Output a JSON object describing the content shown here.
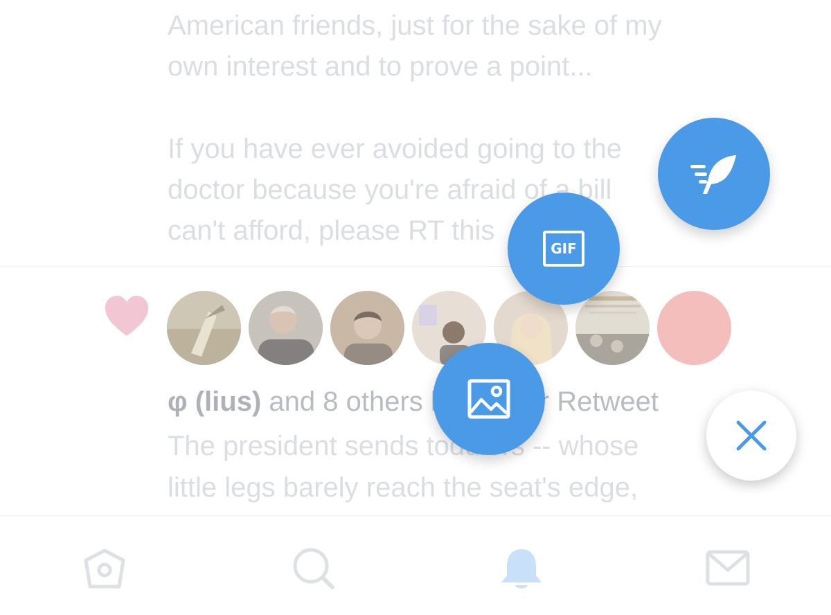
{
  "tweet1": {
    "line1": "American friends, just for the sake of my",
    "line2": "own interest and to prove a point...",
    "line3": "If you have ever avoided going to the",
    "line4": "doctor because you're afraid of a bill",
    "line5": "can't afford, please RT this"
  },
  "notification": {
    "actor": "φ (lius)",
    "summary_pre": " and 8 others liked your Retweet",
    "tweet_line1": "The president sends toddlers -- whose",
    "tweet_line2": "little legs barely reach the seat's edge,"
  },
  "avatars": [
    {
      "name": "avatar-1",
      "color": "#cfc8b8"
    },
    {
      "name": "avatar-2",
      "color": "#bdb7b1"
    },
    {
      "name": "avatar-3",
      "color": "#c4b6a8"
    },
    {
      "name": "avatar-4",
      "color": "#e6ddd4"
    },
    {
      "name": "avatar-5",
      "color": "#e3d6cc"
    },
    {
      "name": "avatar-6",
      "color": "#d9d3c7"
    },
    {
      "name": "avatar-7",
      "color": "#f4bebc"
    }
  ],
  "fab_menu": {
    "compose_icon": "quill-compose-icon",
    "gif_label": "GIF",
    "image_icon": "image-icon",
    "close_icon": "close-icon",
    "accent": "#4a9ae8"
  },
  "tabs": [
    {
      "name": "home",
      "icon": "home-icon"
    },
    {
      "name": "search",
      "icon": "search-icon"
    },
    {
      "name": "notifications",
      "icon": "bell-icon",
      "active": true
    },
    {
      "name": "messages",
      "icon": "mail-icon"
    }
  ],
  "colors": {
    "faded_text": "#dadee3",
    "heart": "#f2c6d3",
    "tab_inactive": "#dde1e6",
    "tab_active": "#c9e1f8"
  }
}
